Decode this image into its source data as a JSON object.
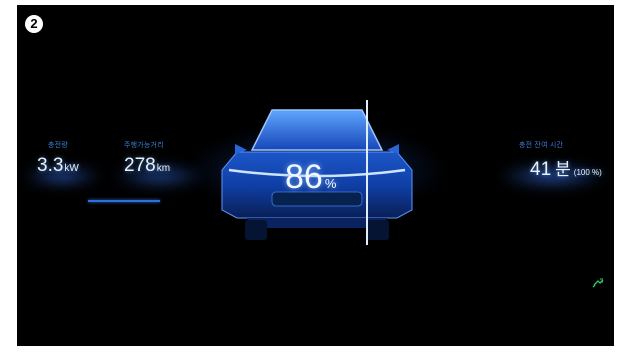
{
  "step": {
    "number": "2"
  },
  "stats": {
    "charge_amount": {
      "label": "충전량",
      "value": "3.3",
      "unit": "kW"
    },
    "driving_range": {
      "label": "주행가능거리",
      "value": "278",
      "unit": "km"
    },
    "remaining_time": {
      "label": "충전 잔여 시간",
      "value": "41",
      "unit": "분",
      "extra": "(100 %)"
    }
  },
  "battery": {
    "value": "86",
    "unit": "%"
  },
  "charge_progress": {
    "fraction": 0.3
  },
  "colors": {
    "accent": "#2f6fd9",
    "background": "#000000",
    "text": "#e8f2ff",
    "plug": "#2fd06a"
  },
  "icons": {
    "car": "car-icon",
    "plug": "charging-plug-icon"
  }
}
